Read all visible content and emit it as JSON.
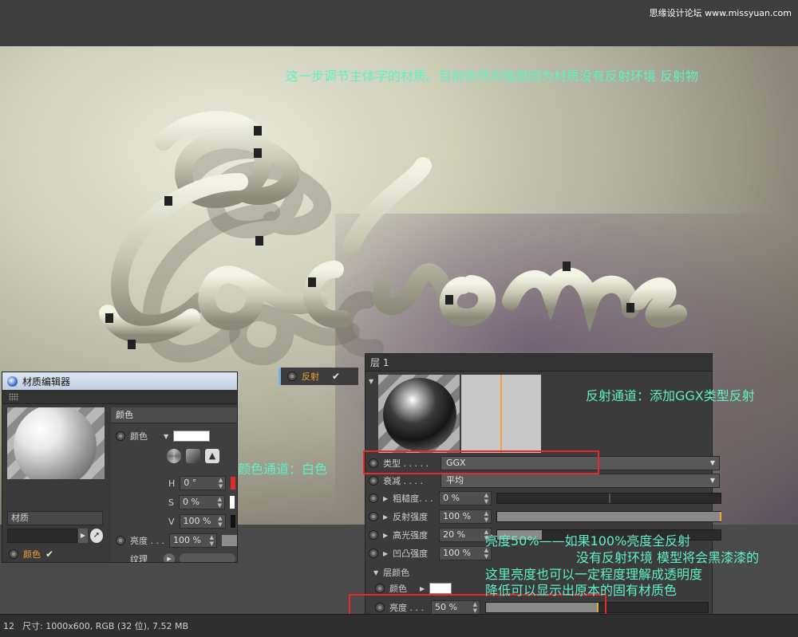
{
  "watermark": "思缘设计论坛 www.missyuan.com",
  "annotations": {
    "top": "这一步调节主体字的材质。目前依然灰暗是因为材质没有反射环境 反射物",
    "color_channel": "颜色通道：白色",
    "reflect_channel": "反射通道：添加GGX类型反射",
    "brightness_1": "亮度50%——如果100%亮度全反射",
    "brightness_2": "没有反射环境 模型将会黑漆漆的",
    "brightness_3": "这里亮度也可以一定程度理解成透明度",
    "brightness_4": "降低可以显示出原本的固有材质色"
  },
  "material_editor": {
    "title": "材质编辑器",
    "material_name": "材质",
    "channel_label": "颜色",
    "section_header": "颜色",
    "color_label": "颜色",
    "h_label": "H",
    "h_value": "0 °",
    "s_label": "S",
    "s_value": "0 %",
    "v_label": "V",
    "v_value": "100 %",
    "brightness_label": "亮度 . . .",
    "brightness_value": "100 %",
    "texture_label": "纹理"
  },
  "reflectance_tab": {
    "label": "反射"
  },
  "layer_panel": {
    "title": "层 1",
    "type_label": "类型 . . . . .",
    "type_value": "GGX",
    "attenuation_label": "衰减 . . . .",
    "attenuation_value": "平均",
    "roughness_label": "粗糙度. . .",
    "roughness_value": "0 %",
    "reflect_strength_label": "反射强度",
    "reflect_strength_value": "100 %",
    "specular_strength_label": "高光强度",
    "specular_strength_value": "20 %",
    "bump_strength_label": "凹凸强度",
    "bump_strength_value": "100 %",
    "layer_color_header": "层颜色",
    "color_label": "颜色",
    "brightness_label": "亮度 . . .",
    "brightness_value": "50 %"
  },
  "statusbar": {
    "left_number": "12",
    "info": "尺寸: 1000x600, RGB (32 位), 7.52 MB"
  },
  "colors": {
    "annotation": "#5ff0c8",
    "accent_orange": "#f2a02e",
    "highlight_red": "#e22b2b"
  },
  "icons": [
    "c4d-logo-icon",
    "cursor-arrow-icon",
    "checkmark-icon",
    "dropdown-chevron-icon",
    "radio-icon"
  ]
}
